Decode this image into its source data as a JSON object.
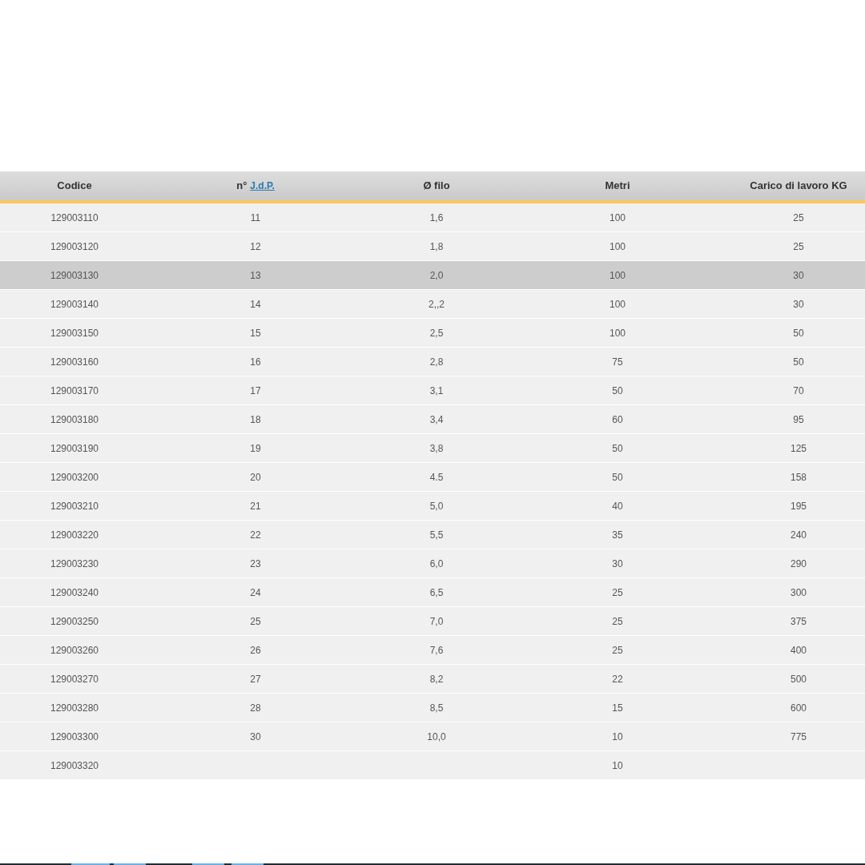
{
  "table": {
    "columns": [
      {
        "label": "Codice"
      },
      {
        "label": "n°",
        "link": "J.d.P."
      },
      {
        "label": "Ø filo"
      },
      {
        "label": "Metri"
      },
      {
        "label": "Carico di lavoro KG"
      }
    ],
    "rows": [
      {
        "cells": [
          "129003110",
          "11",
          "1,6",
          "100",
          "25"
        ],
        "selected": false
      },
      {
        "cells": [
          "129003120",
          "12",
          "1,8",
          "100",
          "25"
        ],
        "selected": false
      },
      {
        "cells": [
          "129003130",
          "13",
          "2,0",
          "100",
          "30"
        ],
        "selected": true
      },
      {
        "cells": [
          "129003140",
          "14",
          "2,,2",
          "100",
          "30"
        ],
        "selected": false
      },
      {
        "cells": [
          "129003150",
          "15",
          "2,5",
          "100",
          "50"
        ],
        "selected": false
      },
      {
        "cells": [
          "129003160",
          "16",
          "2,8",
          "75",
          "50"
        ],
        "selected": false
      },
      {
        "cells": [
          "129003170",
          "17",
          "3,1",
          "50",
          "70"
        ],
        "selected": false
      },
      {
        "cells": [
          "129003180",
          "18",
          "3,4",
          "60",
          "95"
        ],
        "selected": false
      },
      {
        "cells": [
          "129003190",
          "19",
          "3,8",
          "50",
          "125"
        ],
        "selected": false
      },
      {
        "cells": [
          "129003200",
          "20",
          "4.5",
          "50",
          "158"
        ],
        "selected": false
      },
      {
        "cells": [
          "129003210",
          "21",
          "5,0",
          "40",
          "195"
        ],
        "selected": false
      },
      {
        "cells": [
          "129003220",
          "22",
          "5,5",
          "35",
          "240"
        ],
        "selected": false
      },
      {
        "cells": [
          "129003230",
          "23",
          "6,0",
          "30",
          "290"
        ],
        "selected": false
      },
      {
        "cells": [
          "129003240",
          "24",
          "6,5",
          "25",
          "300"
        ],
        "selected": false
      },
      {
        "cells": [
          "129003250",
          "25",
          "7,0",
          "25",
          "375"
        ],
        "selected": false
      },
      {
        "cells": [
          "129003260",
          "26",
          "7,6",
          "25",
          "400"
        ],
        "selected": false
      },
      {
        "cells": [
          "129003270",
          "27",
          "8,2",
          "22",
          "500"
        ],
        "selected": false
      },
      {
        "cells": [
          "129003280",
          "28",
          "8,5",
          "15",
          "600"
        ],
        "selected": false
      },
      {
        "cells": [
          "129003300",
          "30",
          "10,0",
          "10",
          "775"
        ],
        "selected": false
      },
      {
        "cells": [
          "129003320",
          "",
          "",
          "10",
          ""
        ],
        "selected": false
      }
    ]
  }
}
